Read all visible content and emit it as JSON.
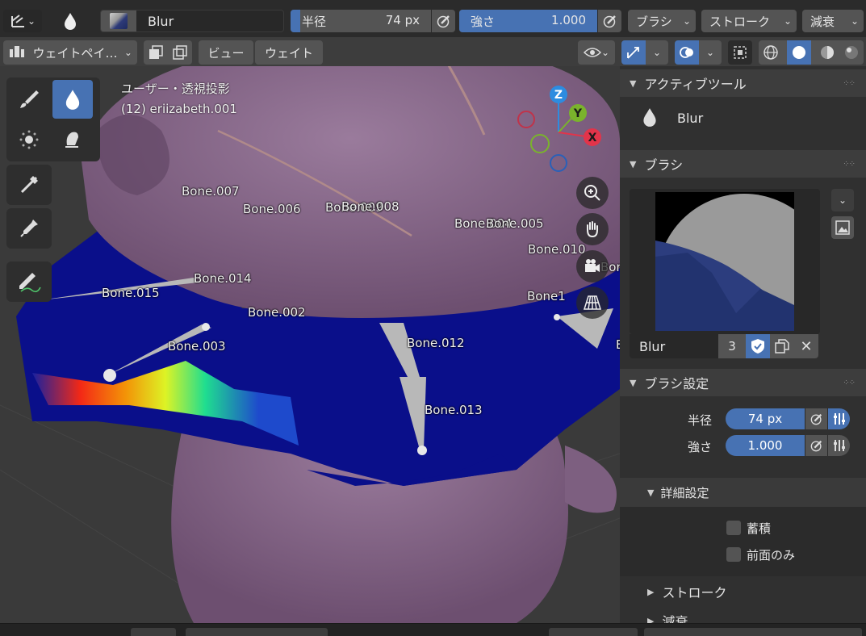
{
  "header": {
    "brush_name": "Blur",
    "radius_label": "半径",
    "radius_value": "74 px",
    "radius_fraction": 0.07,
    "strength_label": "強さ",
    "strength_value": "1.000",
    "strength_fraction": 1.0,
    "brush_menu": "ブラシ",
    "stroke_menu": "ストローク",
    "falloff_menu": "減衰"
  },
  "toolbar2": {
    "mode_label": "ウェイトペイ…",
    "view_menu": "ビュー",
    "weight_menu": "ウェイト"
  },
  "viewport": {
    "view_name": "ユーザー・透視投影",
    "object_name": "(12) eriizabeth.001",
    "gizmo": {
      "z": "Z",
      "y": "Y",
      "x": "X"
    },
    "bones": [
      "Bone.007",
      "Bone.006",
      "Bone.009",
      "Bone.008",
      "Bone.004",
      "Bone.005",
      "Bone.010",
      "Bon",
      "Bone.014",
      "Bone.015",
      "Bone1",
      "Bone.002",
      "Bone.012",
      "Bone.003",
      "Bone.013",
      "B"
    ]
  },
  "panel": {
    "active_tool_title": "アクティブツール",
    "active_tool_name": "Blur",
    "brush_section_title": "ブラシ",
    "brush_name": "Blur",
    "brush_users": "3",
    "brush_settings_title": "ブラシ設定",
    "radius_label": "半径",
    "radius_value": "74 px",
    "strength_label": "強さ",
    "strength_value": "1.000",
    "advanced_title": "詳細設定",
    "accumulate_label": "蓄積",
    "front_faces_label": "前面のみ",
    "stroke_title": "ストローク",
    "falloff_title": "減衰"
  },
  "colors": {
    "accent": "#4772b3",
    "header_bg": "#2b2b2b",
    "panel_bg": "#303030",
    "mesh": "#8e6b8f"
  }
}
